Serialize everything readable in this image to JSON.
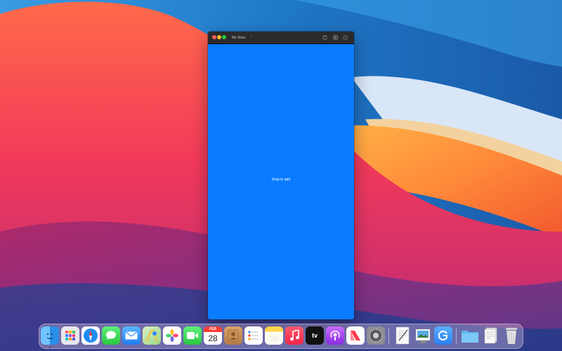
{
  "window": {
    "title": "My Slots",
    "drop_hint": "Drop to add",
    "background_color": "#0a7cff",
    "toolbar_icons": [
      "refresh-icon",
      "add-icon",
      "gear-icon"
    ]
  },
  "dock": {
    "apps": [
      {
        "name": "finder",
        "running": true
      },
      {
        "name": "launchpad",
        "running": false
      },
      {
        "name": "safari",
        "running": false
      },
      {
        "name": "messages",
        "running": false
      },
      {
        "name": "mail",
        "running": false
      },
      {
        "name": "maps",
        "running": false
      },
      {
        "name": "photos",
        "running": false
      },
      {
        "name": "facetime",
        "running": false
      },
      {
        "name": "calendar",
        "running": false
      },
      {
        "name": "contacts",
        "running": false
      },
      {
        "name": "reminders",
        "running": false
      },
      {
        "name": "notes",
        "running": false
      },
      {
        "name": "music",
        "running": false
      },
      {
        "name": "tv",
        "running": false
      },
      {
        "name": "podcasts",
        "running": false
      },
      {
        "name": "news",
        "running": false
      },
      {
        "name": "system-preferences",
        "running": false
      },
      {
        "name": "textedit",
        "running": false
      },
      {
        "name": "preview",
        "running": false
      },
      {
        "name": "app-g",
        "running": false
      },
      {
        "name": "downloads-folder",
        "running": false
      },
      {
        "name": "documents-stack",
        "running": false
      },
      {
        "name": "trash",
        "running": false
      }
    ],
    "calendar": {
      "month": "FEB",
      "day": "28"
    },
    "tv_label": "tv"
  }
}
